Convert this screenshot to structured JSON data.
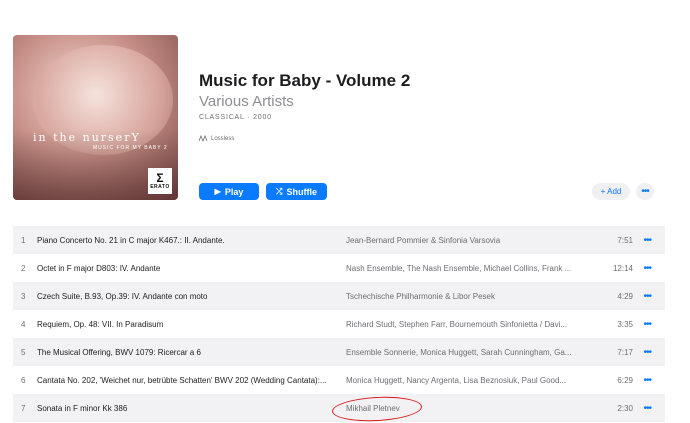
{
  "album": {
    "cover": {
      "title_art": "in the nurserY",
      "subtitle_art": "MUSIC FOR MY BABY 2",
      "label_logo": "ERATO"
    },
    "title": "Music for Baby - Volume 2",
    "artist": "Various Artists",
    "meta": "CLASSICAL · 2000",
    "badge": "Lossless"
  },
  "actions": {
    "play": "Play",
    "shuffle": "Shuffle",
    "add": "+ Add",
    "more": "•••"
  },
  "tracks": [
    {
      "num": "1",
      "title": "Piano Concerto No. 21 in C major K467.: II. Andante.",
      "artist": "Jean-Bernard Pommier & Sinfonia Varsovia",
      "duration": "7:51"
    },
    {
      "num": "2",
      "title": "Octet in F major D803: IV. Andante",
      "artist": "Nash Ensemble, The Nash Ensemble, Michael Collins, Frank ...",
      "duration": "12:14"
    },
    {
      "num": "3",
      "title": "Czech Suite, B.93, Op.39: IV. Andante con moto",
      "artist": "Tschechische Philharmonie & Libor Pesek",
      "duration": "4:29"
    },
    {
      "num": "4",
      "title": "Requiem, Op. 48: VII. In Paradisum",
      "artist": "Richard Studt, Stephen Farr, Bournemouth Sinfonietta / Davi...",
      "duration": "3:35"
    },
    {
      "num": "5",
      "title": "The Musical Offering, BWV 1079: Ricercar a 6",
      "artist": "Ensemble Sonnerie, Monica Huggett, Sarah Cunningham, Ga...",
      "duration": "7:17"
    },
    {
      "num": "6",
      "title": "Cantata No. 202, 'Weichet nur, betrübte Schatten' BWV 202 (Wedding Cantata):...",
      "artist": "Monica Huggett, Nancy Argenta, Lisa Beznosiuk, Paul Good...",
      "duration": "6:29"
    },
    {
      "num": "7",
      "title": "Sonata in F minor Kk 386",
      "artist": "Mikhail Pletnev",
      "duration": "2:30"
    }
  ],
  "colors": {
    "accent": "#0a7aff",
    "annotation": "#d81a1a"
  }
}
